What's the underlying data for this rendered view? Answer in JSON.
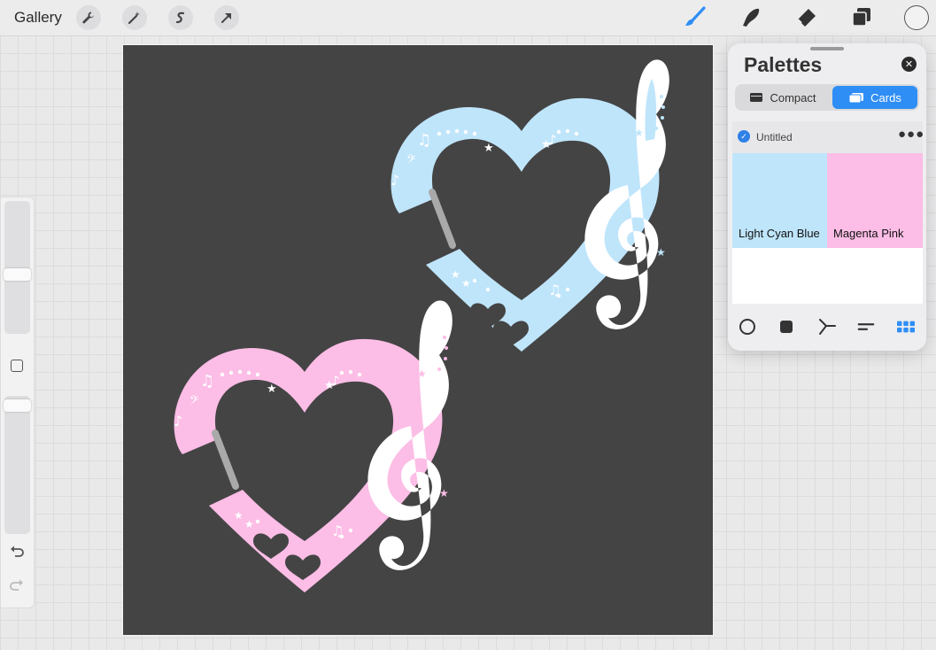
{
  "topbar": {
    "gallery_label": "Gallery",
    "left_tools": [
      "wrench-icon",
      "magic-wand-icon",
      "selection-icon",
      "transform-arrow-icon"
    ],
    "right_tools": [
      "brush-icon",
      "smudge-icon",
      "eraser-icon",
      "layers-icon"
    ],
    "current_color": "#f2f2f3",
    "accent_color": "#2f8ef5"
  },
  "sidebar": {
    "brush_size_level": 0.55,
    "opacity_level": 0.0,
    "undo_icon": "undo-icon",
    "redo_icon": "redo-icon"
  },
  "canvas": {
    "background": "#444444",
    "artwork": [
      {
        "name": "blue-heart-clef",
        "color": "#bfe5fb"
      },
      {
        "name": "pink-heart-clef",
        "color": "#fcbde6"
      }
    ]
  },
  "palettes": {
    "title": "Palettes",
    "tabs": [
      {
        "label": "Compact",
        "active": false
      },
      {
        "label": "Cards",
        "active": true
      }
    ],
    "palette_name": "Untitled",
    "swatches": [
      {
        "name": "Light Cyan Blue",
        "hex": "#bfe5fb"
      },
      {
        "name": "Magenta Pink",
        "hex": "#fcbde6"
      }
    ],
    "bottom_tools": [
      "disc-icon",
      "classic-icon",
      "harmony-icon",
      "value-icon",
      "palettes-grid-icon"
    ]
  }
}
